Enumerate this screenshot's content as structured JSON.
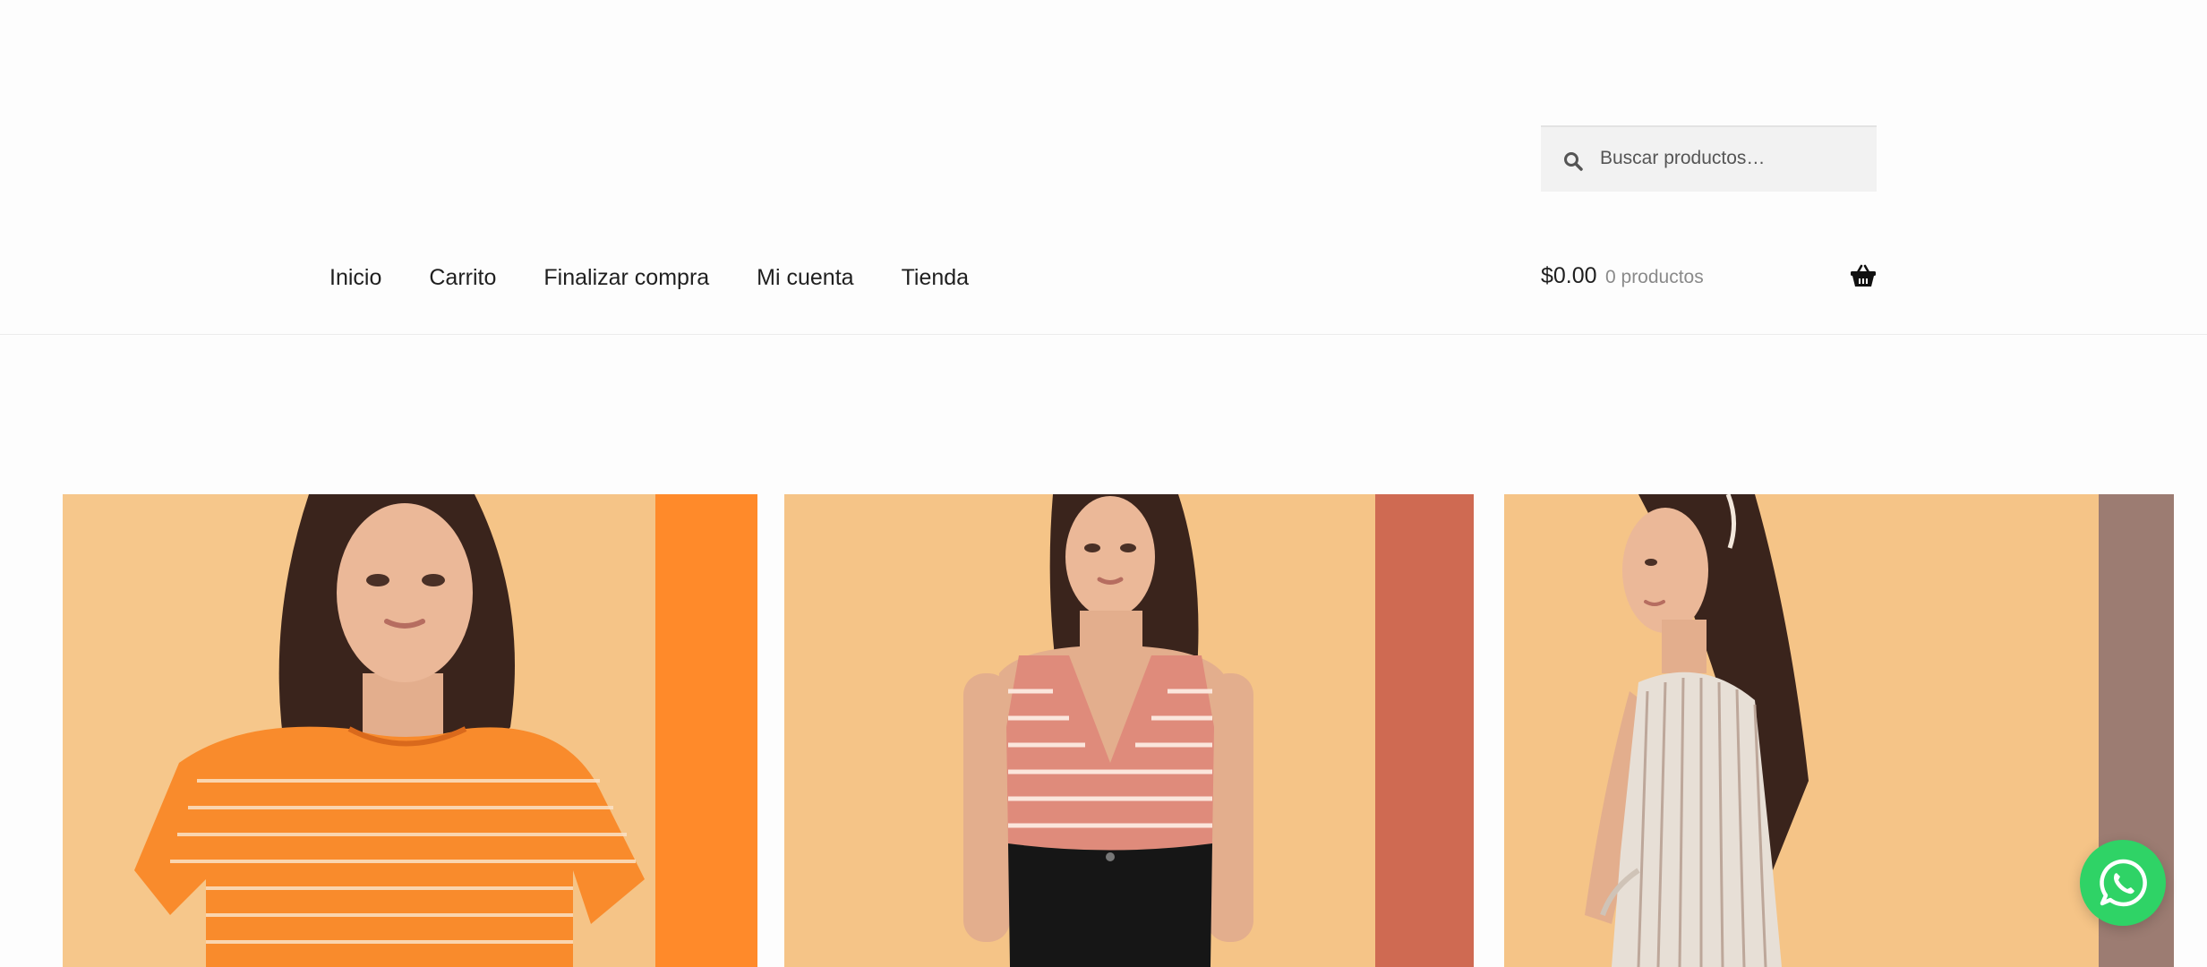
{
  "search": {
    "placeholder": "Buscar productos…",
    "icon": "search-icon"
  },
  "nav": {
    "items": [
      {
        "label": "Inicio"
      },
      {
        "label": "Carrito"
      },
      {
        "label": "Finalizar compra"
      },
      {
        "label": "Mi cuenta"
      },
      {
        "label": "Tienda"
      }
    ]
  },
  "cart": {
    "total": "$0.00",
    "count": "0 productos",
    "icon": "basket-icon"
  },
  "products": [
    {
      "name": "orange-striped-tshirt",
      "accent": "#ff8a2a",
      "background": "#f6c588"
    },
    {
      "name": "coral-striped-tank-top",
      "accent": "#cf6a52",
      "background": "#f6c588"
    },
    {
      "name": "striped-linen-dress",
      "accent": "#9c7c72",
      "background": "#f6c588"
    }
  ],
  "colors": {
    "whatsapp_green": "#2fd366",
    "page_background": "#fdfdfd"
  },
  "floating": {
    "whatsapp_icon": "whatsapp-icon"
  }
}
